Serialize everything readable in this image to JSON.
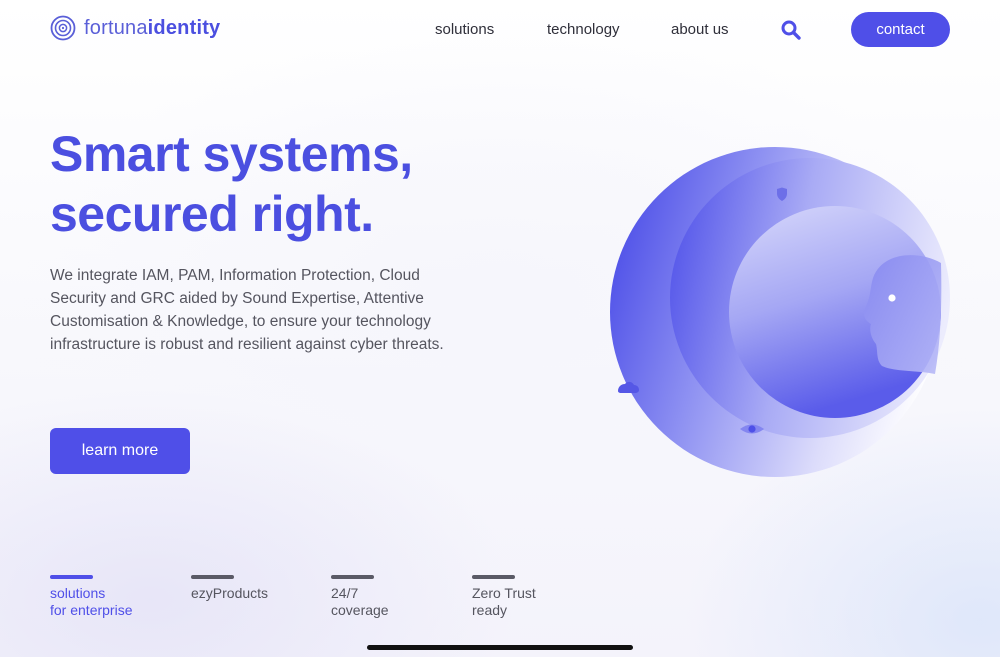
{
  "header": {
    "logo": {
      "part1": "fortuna",
      "part2": "identity"
    },
    "nav": [
      {
        "label": "solutions"
      },
      {
        "label": "technology"
      },
      {
        "label": "about us"
      }
    ],
    "search_icon": "search-icon",
    "contact_label": "contact"
  },
  "hero": {
    "title_line1": "Smart systems,",
    "title_line2": "secured right.",
    "description": "We integrate IAM, PAM, Information Protection, Cloud Security and GRC aided by Sound Expertise, Attentive Customisation & Knowledge, to ensure your technology infrastructure is robust and resilient against cyber threats.",
    "cta_label": "learn more"
  },
  "tabs": [
    {
      "label": "solutions\nfor enterprise",
      "active": true
    },
    {
      "label": "ezyProducts",
      "active": false
    },
    {
      "label": "24/7\ncoverage",
      "active": false
    },
    {
      "label": "Zero Trust\nready",
      "active": false
    }
  ],
  "colors": {
    "accent": "#4f4fe8",
    "title": "#4b4fe0",
    "text": "#55555f"
  },
  "icons": [
    "fingerprint-logo-icon",
    "search-icon",
    "shield-icon",
    "eye-icon",
    "cloud-icon",
    "face-profile-icon"
  ]
}
